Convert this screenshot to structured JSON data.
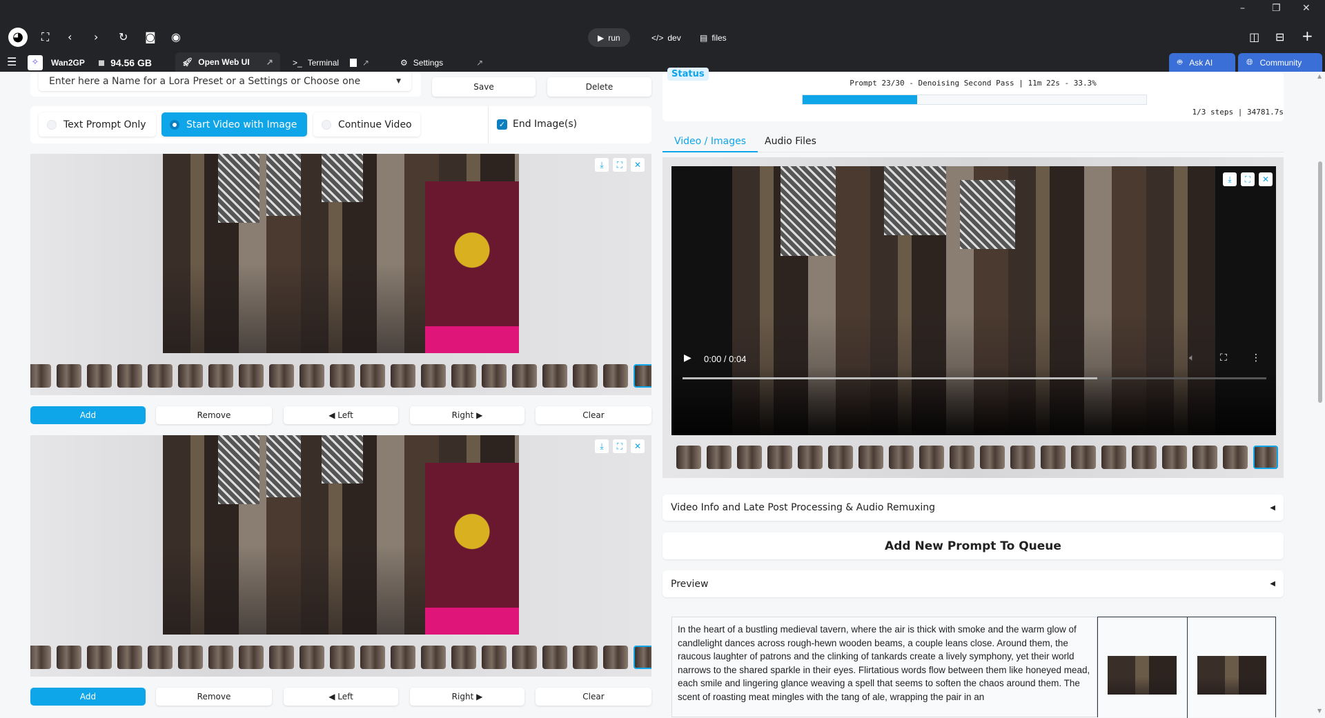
{
  "titlebar": {
    "minimize": "–",
    "restore": "❐",
    "close": "✕"
  },
  "toolbar": {
    "run_label": "run",
    "dev_label": "dev",
    "files_label": "files"
  },
  "tabs": {
    "app_name": "Wan2GP",
    "storage": "94.56 GB",
    "open_web_ui": "Open Web UI",
    "terminal": "Terminal",
    "settings": "Settings",
    "ask_ai": "Ask AI",
    "community": "Community"
  },
  "lora": {
    "placeholder": "Enter here a Name for a Lora Preset or a Settings or Choose one",
    "save": "Save",
    "delete": "Delete"
  },
  "mode": {
    "options": [
      "Text Prompt Only",
      "Start Video with Image",
      "Continue Video"
    ],
    "selected": "Start Video with Image",
    "end_images_label": "End Image(s)",
    "end_images_checked": true
  },
  "image_buttons": {
    "add": "Add",
    "remove": "Remove",
    "left": "◀ Left",
    "right": "Right ▶",
    "clear": "Clear"
  },
  "status": {
    "label": "Status",
    "progress_text": "Prompt 23/30 - Denoising Second Pass | 11m 22s - 33.3%",
    "progress": 0.333,
    "steps_text": "1/3 steps | 34781.7s"
  },
  "output_tabs": [
    "Video / Images",
    "Audio Files"
  ],
  "active_output_tab": "Video / Images",
  "video": {
    "time": "0:00 / 0:04",
    "played_fraction": 0.71
  },
  "accordions": {
    "video_info": "Video Info and Late Post Processing & Audio Remuxing",
    "add_prompt": "Add New Prompt To Queue",
    "preview": "Preview",
    "collapsed_icon": "◀"
  },
  "prompt_preview": "In the heart of a bustling medieval tavern, where the air is thick with smoke and the warm glow of candlelight dances across rough-hewn wooden beams, a couple leans close. Around them, the raucous laughter of patrons and the clinking of tankards create a lively symphony, yet their world narrows to the shared sparkle in their eyes. Flirtatious words flow between them like honeyed mead, each smile and lingering glance weaving a spell that seems to soften the chaos around them. The scent of roasting meat mingles with the tang of ale, wrapping the pair in an",
  "colors": {
    "accent": "#0ea5e9",
    "topbar": "#232427",
    "brand_blue": "#3b6fd8"
  }
}
